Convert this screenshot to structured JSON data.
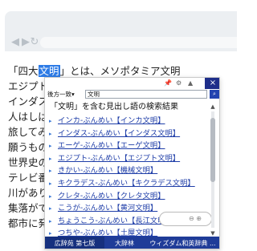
{
  "browser": {
    "back_icon": "arrow-left-icon",
    "forward_icon": "arrow-right-icon",
    "reload_icon": "reload-icon"
  },
  "article": {
    "line1_before": "「四大",
    "line1_highlight": "文明",
    "line1_after": "」とは、メソポタミア文明",
    "line2": "エジプト",
    "line3": "インダス",
    "line4": "人はしば",
    "line5": "旅してみ",
    "line6": "願うもの",
    "line7": "世界史の",
    "line8": "テレビ番",
    "line9": "川があり",
    "line10": "集落がで",
    "line11": "都市に発"
  },
  "popup": {
    "pin_icon": "pin-icon",
    "settings_icon": "gear-icon",
    "collapse_icon": "chevron-up-icon",
    "close_label": "×",
    "mode_label": "後方一致",
    "mode_arrow": "▾",
    "query_value": "文明",
    "results_title": "「文明」を含む見出し語の検索結果",
    "results": [
      "インカ-ぶんめい【インカ文明】",
      "インダス-ぶんめい【インダス文明】",
      "エーゲ-ぶんめい【エーゲ文明】",
      "エジプト-ぶんめい【エジプト文明】",
      "きかい-ぶんめい【機械文明】",
      "キクラデス-ぶんめい【キクラデス文明】",
      "クレタ-ぶんめい【クレタ文明】",
      "こうが-ぶんめい【黄河文明】",
      "ちょうこう-ぶんめい【長江文明】",
      "つちや-ぶんめい【土屋文明】"
    ],
    "tabs": [
      "広辞苑 第七版",
      "大辞林",
      "ウィズダム和英辞典 ..."
    ],
    "accent_color": "#1f3c98"
  }
}
